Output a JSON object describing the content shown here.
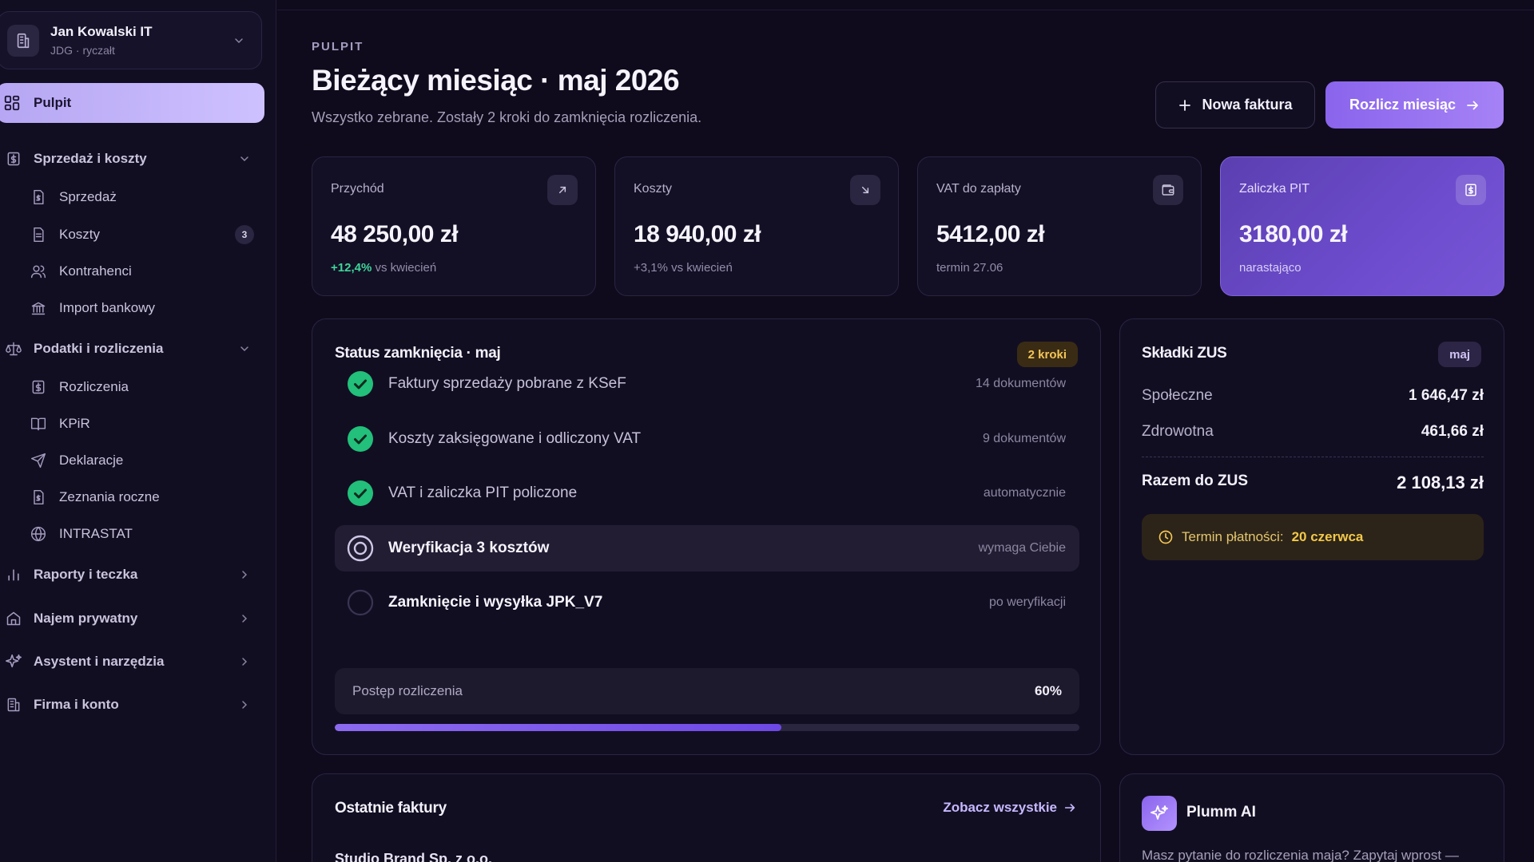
{
  "org": {
    "name": "Jan Kowalski IT",
    "subtitle": "JDG · ryczałt"
  },
  "nav": {
    "pulpit": "Pulpit",
    "sections": [
      {
        "label": "Sprzedaż i koszty",
        "items": [
          {
            "label": "Sprzedaż"
          },
          {
            "label": "Koszty",
            "badge": "3"
          },
          {
            "label": "Kontrahenci"
          },
          {
            "label": "Import bankowy"
          }
        ]
      },
      {
        "label": "Podatki i rozliczenia",
        "items": [
          {
            "label": "Rozliczenia"
          },
          {
            "label": "KPiR"
          },
          {
            "label": "Deklaracje"
          },
          {
            "label": "Zeznania roczne"
          },
          {
            "label": "INTRASTAT"
          }
        ]
      },
      {
        "label": "Raporty i teczka"
      },
      {
        "label": "Najem prywatny"
      },
      {
        "label": "Asystent i narzędzia"
      },
      {
        "label": "Firma i konto"
      }
    ]
  },
  "header": {
    "eyebrow": "PULPIT",
    "title": "Bieżący miesiąc · maj 2026",
    "subtitle": "Wszystko zebrane. Zostały 2 kroki do zamknięcia rozliczenia.",
    "new_invoice": "Nowa faktura",
    "settle": "Rozlicz miesiąc"
  },
  "kpis": [
    {
      "label": "Przychód",
      "value": "48 250,00 zł",
      "delta": "+12,4%",
      "foot": "vs kwiecień"
    },
    {
      "label": "Koszty",
      "value": "18 940,00 zł",
      "foot": "+3,1% vs kwiecień"
    },
    {
      "label": "VAT do zapłaty",
      "value": "5412,00 zł",
      "foot": "termin 27.06"
    },
    {
      "label": "Zaliczka PIT",
      "value": "3180,00 zł",
      "foot": "narastająco"
    }
  ],
  "status": {
    "title": "Status zamknięcia · maj",
    "badge": "2 kroki",
    "steps": [
      {
        "label": "Faktury sprzedaży pobrane z KSeF",
        "meta": "14 dokumentów",
        "state": "done"
      },
      {
        "label": "Koszty zaksięgowane i odliczony VAT",
        "meta": "9 dokumentów",
        "state": "done"
      },
      {
        "label": "VAT i zaliczka PIT policzone",
        "meta": "automatycznie",
        "state": "done"
      },
      {
        "label": "Weryfikacja 3 kosztów",
        "meta": "wymaga Ciebie",
        "state": "active"
      },
      {
        "label": "Zamknięcie i wysyłka JPK_V7",
        "meta": "po weryfikacji",
        "state": "pending"
      }
    ],
    "progress_label": "Postęp rozliczenia",
    "progress_text": "60%",
    "progress": 0.6
  },
  "zus": {
    "title": "Składki ZUS",
    "badge": "maj",
    "rows": [
      {
        "label": "Społeczne",
        "value": "1 646,47 zł"
      },
      {
        "label": "Zdrowotna",
        "value": "461,66 zł"
      }
    ],
    "total_label": "Razem do ZUS",
    "total_value": "2 108,13 zł",
    "due_label": "Termin płatności:",
    "due_value": "20 czerwca"
  },
  "invoices": {
    "title": "Ostatnie faktury",
    "see_all": "Zobacz wszystkie",
    "first_row": "Studio Brand Sp. z o.o."
  },
  "ai": {
    "title": "Plumm AI",
    "text": "Masz pytanie do rozliczenia maja? Zapytaj wprost —"
  },
  "colors": {
    "accent": "#8a64ec",
    "success": "#22c07a",
    "warning": "#f3c558",
    "background": "#0f0b1c"
  }
}
